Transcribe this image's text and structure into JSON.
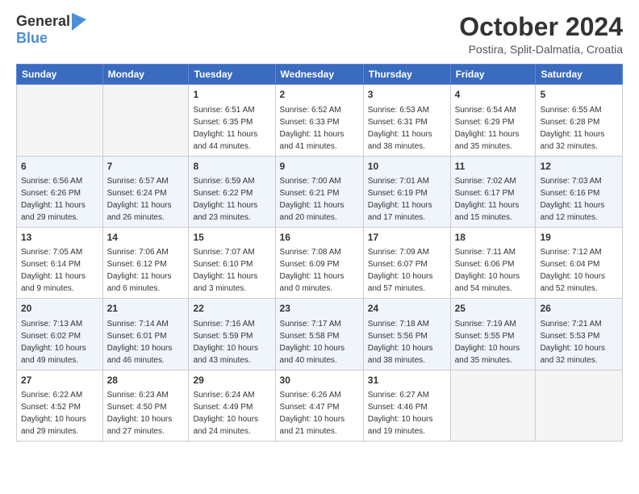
{
  "header": {
    "logo_general": "General",
    "logo_blue": "Blue",
    "month": "October 2024",
    "location": "Postira, Split-Dalmatia, Croatia"
  },
  "weekdays": [
    "Sunday",
    "Monday",
    "Tuesday",
    "Wednesday",
    "Thursday",
    "Friday",
    "Saturday"
  ],
  "weeks": [
    [
      null,
      null,
      {
        "day": 1,
        "sunrise": "6:51 AM",
        "sunset": "6:35 PM",
        "daylight": "11 hours and 44 minutes."
      },
      {
        "day": 2,
        "sunrise": "6:52 AM",
        "sunset": "6:33 PM",
        "daylight": "11 hours and 41 minutes."
      },
      {
        "day": 3,
        "sunrise": "6:53 AM",
        "sunset": "6:31 PM",
        "daylight": "11 hours and 38 minutes."
      },
      {
        "day": 4,
        "sunrise": "6:54 AM",
        "sunset": "6:29 PM",
        "daylight": "11 hours and 35 minutes."
      },
      {
        "day": 5,
        "sunrise": "6:55 AM",
        "sunset": "6:28 PM",
        "daylight": "11 hours and 32 minutes."
      }
    ],
    [
      {
        "day": 6,
        "sunrise": "6:56 AM",
        "sunset": "6:26 PM",
        "daylight": "11 hours and 29 minutes."
      },
      {
        "day": 7,
        "sunrise": "6:57 AM",
        "sunset": "6:24 PM",
        "daylight": "11 hours and 26 minutes."
      },
      {
        "day": 8,
        "sunrise": "6:59 AM",
        "sunset": "6:22 PM",
        "daylight": "11 hours and 23 minutes."
      },
      {
        "day": 9,
        "sunrise": "7:00 AM",
        "sunset": "6:21 PM",
        "daylight": "11 hours and 20 minutes."
      },
      {
        "day": 10,
        "sunrise": "7:01 AM",
        "sunset": "6:19 PM",
        "daylight": "11 hours and 17 minutes."
      },
      {
        "day": 11,
        "sunrise": "7:02 AM",
        "sunset": "6:17 PM",
        "daylight": "11 hours and 15 minutes."
      },
      {
        "day": 12,
        "sunrise": "7:03 AM",
        "sunset": "6:16 PM",
        "daylight": "11 hours and 12 minutes."
      }
    ],
    [
      {
        "day": 13,
        "sunrise": "7:05 AM",
        "sunset": "6:14 PM",
        "daylight": "11 hours and 9 minutes."
      },
      {
        "day": 14,
        "sunrise": "7:06 AM",
        "sunset": "6:12 PM",
        "daylight": "11 hours and 6 minutes."
      },
      {
        "day": 15,
        "sunrise": "7:07 AM",
        "sunset": "6:10 PM",
        "daylight": "11 hours and 3 minutes."
      },
      {
        "day": 16,
        "sunrise": "7:08 AM",
        "sunset": "6:09 PM",
        "daylight": "11 hours and 0 minutes."
      },
      {
        "day": 17,
        "sunrise": "7:09 AM",
        "sunset": "6:07 PM",
        "daylight": "10 hours and 57 minutes."
      },
      {
        "day": 18,
        "sunrise": "7:11 AM",
        "sunset": "6:06 PM",
        "daylight": "10 hours and 54 minutes."
      },
      {
        "day": 19,
        "sunrise": "7:12 AM",
        "sunset": "6:04 PM",
        "daylight": "10 hours and 52 minutes."
      }
    ],
    [
      {
        "day": 20,
        "sunrise": "7:13 AM",
        "sunset": "6:02 PM",
        "daylight": "10 hours and 49 minutes."
      },
      {
        "day": 21,
        "sunrise": "7:14 AM",
        "sunset": "6:01 PM",
        "daylight": "10 hours and 46 minutes."
      },
      {
        "day": 22,
        "sunrise": "7:16 AM",
        "sunset": "5:59 PM",
        "daylight": "10 hours and 43 minutes."
      },
      {
        "day": 23,
        "sunrise": "7:17 AM",
        "sunset": "5:58 PM",
        "daylight": "10 hours and 40 minutes."
      },
      {
        "day": 24,
        "sunrise": "7:18 AM",
        "sunset": "5:56 PM",
        "daylight": "10 hours and 38 minutes."
      },
      {
        "day": 25,
        "sunrise": "7:19 AM",
        "sunset": "5:55 PM",
        "daylight": "10 hours and 35 minutes."
      },
      {
        "day": 26,
        "sunrise": "7:21 AM",
        "sunset": "5:53 PM",
        "daylight": "10 hours and 32 minutes."
      }
    ],
    [
      {
        "day": 27,
        "sunrise": "6:22 AM",
        "sunset": "4:52 PM",
        "daylight": "10 hours and 29 minutes."
      },
      {
        "day": 28,
        "sunrise": "6:23 AM",
        "sunset": "4:50 PM",
        "daylight": "10 hours and 27 minutes."
      },
      {
        "day": 29,
        "sunrise": "6:24 AM",
        "sunset": "4:49 PM",
        "daylight": "10 hours and 24 minutes."
      },
      {
        "day": 30,
        "sunrise": "6:26 AM",
        "sunset": "4:47 PM",
        "daylight": "10 hours and 21 minutes."
      },
      {
        "day": 31,
        "sunrise": "6:27 AM",
        "sunset": "4:46 PM",
        "daylight": "10 hours and 19 minutes."
      },
      null,
      null
    ]
  ],
  "labels": {
    "sunrise": "Sunrise:",
    "sunset": "Sunset:",
    "daylight": "Daylight:"
  }
}
